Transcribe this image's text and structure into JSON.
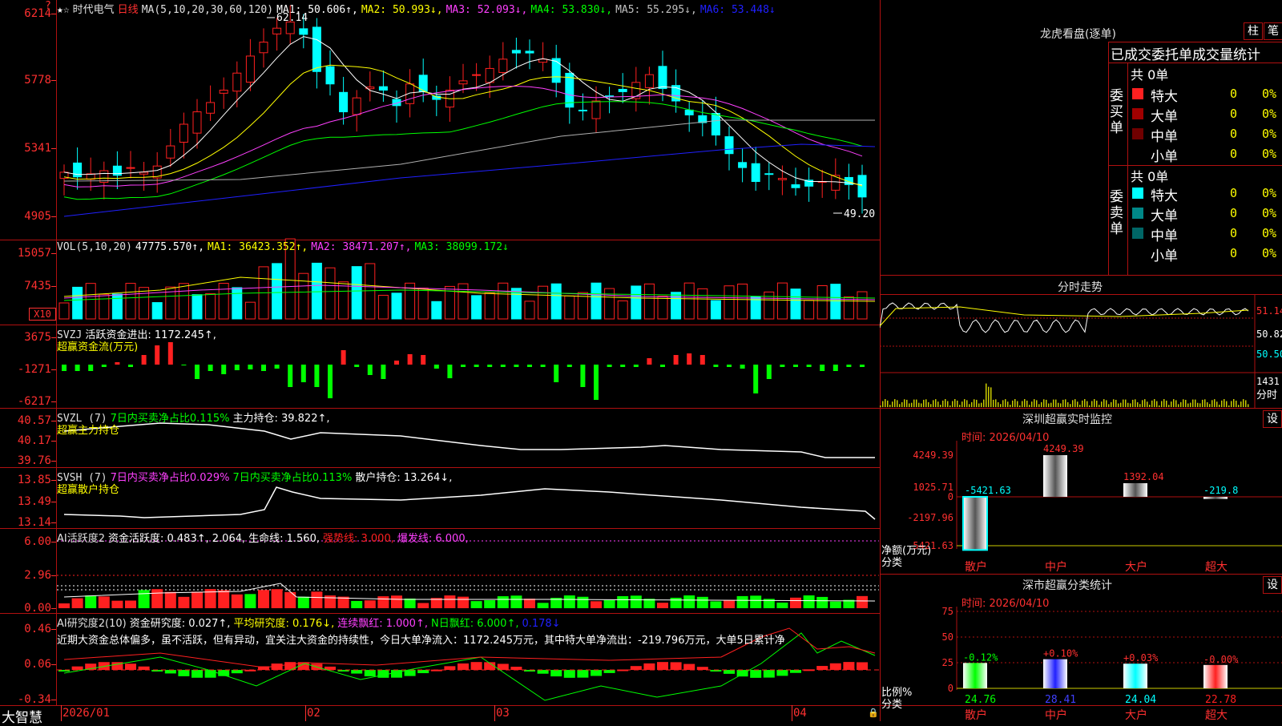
{
  "app": {
    "brand": "大智慧",
    "lock_icon": "lock-icon"
  },
  "kline": {
    "stock": "时代电气",
    "period": "日线",
    "ma_header": "MA(5,10,20,30,60,120)",
    "ma": [
      {
        "label": "MA1: 50.606↑,",
        "color": "#ffffff"
      },
      {
        "label": "MA2: 50.993↓,",
        "color": "#ffff00"
      },
      {
        "label": "MA3: 52.093↓,",
        "color": "#ff40ff"
      },
      {
        "label": "MA4: 53.830↓,",
        "color": "#00ff00"
      },
      {
        "label": "MA5: 55.295↓,",
        "color": "#c0c0c0"
      },
      {
        "label": "MA6: 53.448↓",
        "color": "#2020ff"
      }
    ],
    "y_labels": [
      "6214",
      "5778",
      "5341",
      "4905"
    ],
    "high_mark": "62.14",
    "low_mark": "49.20"
  },
  "vol": {
    "title": "VOL(5,10,20)",
    "value": "47775.570↑,",
    "ma1": "MA1: 36423.352↑,",
    "ma2": "MA2: 38471.207↑,",
    "ma3": "MA3: 38099.172↓",
    "y_labels": [
      "15057",
      "7435"
    ],
    "unit": "X10"
  },
  "svzj": {
    "title": "SVZJ",
    "label": "活跃资金进出: 1172.245↑,",
    "sub": "超赢资金流(万元)",
    "y_labels": [
      "3675",
      "-1271",
      "-6217"
    ]
  },
  "svzl": {
    "title": "SVZL (7)",
    "t1": "7日内买卖净占比0.115%",
    "t2": "主力持仓: 39.822↑,",
    "sub": "超赢主力持仓",
    "y_labels": [
      "40.57",
      "40.17",
      "39.76"
    ]
  },
  "svsh": {
    "title": "SVSH (7)",
    "t1": "7日内买卖净占比0.029%",
    "t2": "7日内买卖净占比0.113%",
    "t3": "散户持仓: 13.264↓,",
    "sub": "超赢散户持仓",
    "y_labels": [
      "13.85",
      "13.49",
      "13.14"
    ]
  },
  "ai1": {
    "title": "AI活跃度2",
    "t1": "资金活跃度: 0.483↑,",
    "t2": "2.064,",
    "t3": "生命线: 1.560,",
    "t4": "强势线: 3.000,",
    "t5": "爆发线: 6.000,",
    "y_labels": [
      "6.00",
      "2.96",
      "0.00"
    ]
  },
  "ai2": {
    "title": "AI研究度2(10)",
    "t1": "资金研究度: 0.027↑,",
    "t2": "平均研究度: 0.176↓,",
    "t3": "连续飘红: 1.000↑,",
    "t4": "N日飘红: 6.000↑,",
    "t5": "0.178↓",
    "comment": "近期大资金总体偏多，虽不活跃，但有异动，宜关注大资金的持续性，今日大单净流入：1172.245万元，其中特大单净流出：-219.796万元，大单5日累计净",
    "y_labels": [
      "0.46",
      "0.06",
      "-0.34"
    ]
  },
  "xaxis": [
    "2026/01",
    "02",
    "03",
    "04"
  ],
  "dragon": {
    "title": "龙虎看盘(逐单)",
    "btn1": "柱",
    "btn2": "笔",
    "header": "已成交委托单成交量统计",
    "buy_label": "委买单",
    "sell_label": "委卖单",
    "buy_total": "共 0单",
    "sell_total": "共 0单",
    "buy_rows": [
      {
        "name": "特大",
        "count": "0",
        "pct": "0%",
        "color": "#ff2020"
      },
      {
        "name": "大单",
        "count": "0",
        "pct": "0%",
        "color": "#a00000"
      },
      {
        "name": "中单",
        "count": "0",
        "pct": "0%",
        "color": "#700000"
      },
      {
        "name": "小单",
        "count": "0",
        "pct": "0%",
        "color": ""
      }
    ],
    "sell_rows": [
      {
        "name": "特大",
        "count": "0",
        "pct": "0%",
        "color": "#00ffff"
      },
      {
        "name": "大单",
        "count": "0",
        "pct": "0%",
        "color": "#008888"
      },
      {
        "name": "中单",
        "count": "0",
        "pct": "0%",
        "color": "#006666"
      },
      {
        "name": "小单",
        "count": "0",
        "pct": "0%",
        "color": ""
      }
    ]
  },
  "intraday": {
    "title": "分时走势",
    "y_labels": [
      "51.14",
      "50.82",
      "50.50",
      "1431"
    ],
    "unit": "分时"
  },
  "monitor": {
    "title": "深圳超赢实时监控",
    "btn": "设",
    "date": "时间: 2026/04/10",
    "y_labels": [
      "4249.39",
      "1025.71",
      "0",
      "-2197.96",
      "-5421.63"
    ],
    "ylabel1": "净额(万元)",
    "ylabel2": "分类",
    "bars": [
      {
        "cat": "散户",
        "value": -5421.63,
        "label": "-5421.63"
      },
      {
        "cat": "中户",
        "value": 4249.39,
        "label": "4249.39"
      },
      {
        "cat": "大户",
        "value": 1392.04,
        "label": "1392.04"
      },
      {
        "cat": "超大",
        "value": -219.8,
        "label": "-219.8"
      }
    ]
  },
  "classify": {
    "title": "深市超赢分类统计",
    "btn": "设",
    "date": "时间: 2026/04/10",
    "y_labels": [
      "75",
      "50",
      "25",
      "0"
    ],
    "ylabel1": "比例%",
    "ylabel2": "分类",
    "bars": [
      {
        "cat": "散户",
        "value": 24.76,
        "label": "24.76",
        "delta": "-0.12%",
        "color": "#00ff00"
      },
      {
        "cat": "中户",
        "value": 28.41,
        "label": "28.41",
        "delta": "+0.10%",
        "color": "#2020ff"
      },
      {
        "cat": "大户",
        "value": 24.04,
        "label": "24.04",
        "delta": "+0.03%",
        "color": "#00ffff"
      },
      {
        "cat": "超大",
        "value": 22.78,
        "label": "22.78",
        "delta": "-0.00%",
        "color": "#ff2020"
      }
    ]
  }
}
